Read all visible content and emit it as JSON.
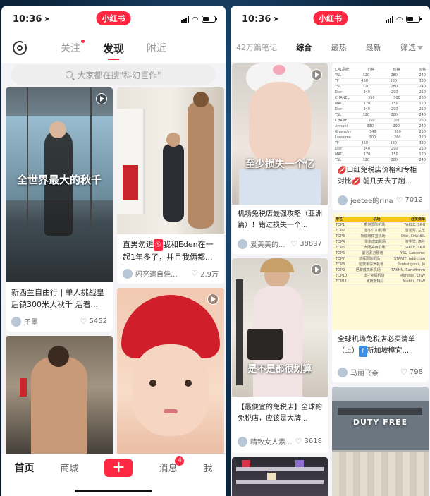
{
  "left_phone": {
    "status": {
      "time": "10:36",
      "brand": "小红书"
    },
    "nav": {
      "tabs": [
        "关注",
        "发现",
        "附近"
      ],
      "active": 1
    },
    "search": {
      "placeholder": "大家都在搜\"科幻巨作\""
    },
    "cards": [
      {
        "overlay": "全世界最大的秋千",
        "caption": "新西兰自由行 | 单人挑战皇后镇300米大秋千 活着...",
        "author": "子墨",
        "likes": "5452"
      },
      {
        "overlay": "",
        "caption_pre": "直男勿进",
        "tag": "⑤",
        "caption_post": "我和Eden在一起1年多了，并且我俩都...",
        "author": "闪亮遗自佳...",
        "likes": "2.9万"
      },
      {
        "overlay": "",
        "caption": "",
        "author": "",
        "likes": ""
      },
      {
        "overlay": "",
        "caption": "",
        "author": "",
        "likes": ""
      }
    ],
    "bottom_nav": {
      "items": [
        "首页",
        "商城",
        "+",
        "消息",
        "我"
      ],
      "message_badge": "4"
    }
  },
  "right_phone": {
    "status": {
      "time": "10:36",
      "brand": "小红书"
    },
    "filters": {
      "count": "42万篇笔记",
      "tabs": [
        "综合",
        "最热",
        "最新",
        "筛选"
      ],
      "active": 0
    },
    "cards": [
      {
        "overlay": "至少损失一个亿",
        "caption": "机场免税店最强攻略（亚洲篇）！错过损失一个...",
        "author": "爱美美的...",
        "likes": "38897"
      },
      {
        "overlay": "",
        "caption_pre": "💋",
        "caption": "口红免税店价格和专柜对比",
        "caption_post": "💋 前几天去了趟...",
        "author": "jeetee的rina",
        "likes": "7012"
      },
      {
        "overlay": "是不是都很划算",
        "caption": "【最便宜的免税店】全球的免税店，应该是大牌...",
        "author": "精致女人素...",
        "likes": "3618"
      },
      {
        "overlay": "",
        "caption_pre": "全球机场免税店必买清单（上）",
        "tag": "↑",
        "caption_post": "新加坡樟宜...",
        "author": "马丽飞荼",
        "likes": "798"
      },
      {
        "overlay": "",
        "caption": "",
        "author": "",
        "likes": ""
      },
      {
        "overlay": "DUTY FREE",
        "caption": "",
        "author": "",
        "likes": ""
      }
    ]
  },
  "colors": {
    "accent": "#ff2741",
    "background": "#0d2740"
  }
}
